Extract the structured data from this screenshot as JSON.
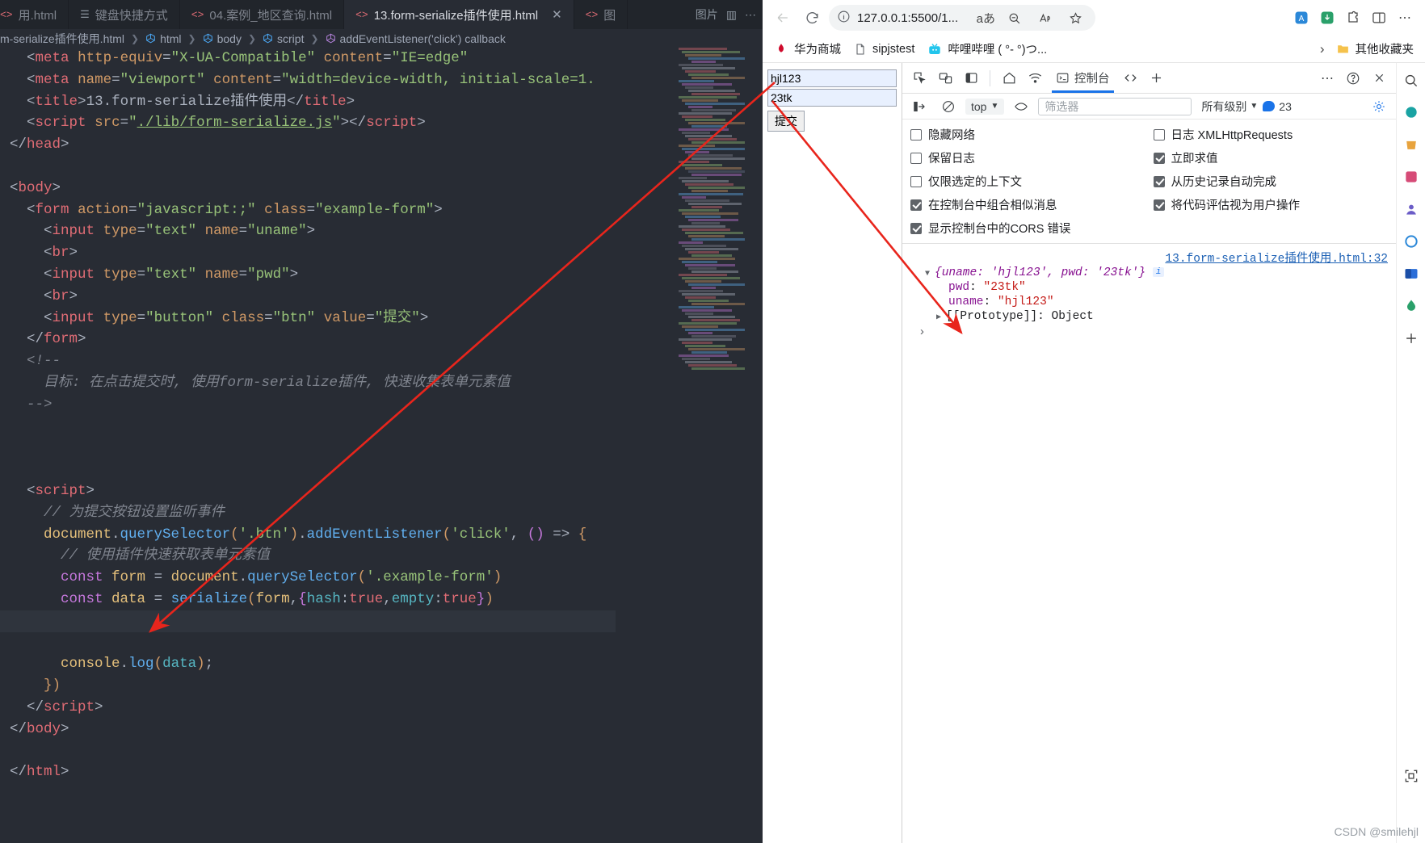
{
  "editor": {
    "tabs": [
      {
        "label": "用.html",
        "icon": "html-file-icon",
        "active": false,
        "closable": false
      },
      {
        "label": "键盘快捷方式",
        "icon": "keyboard-shortcuts-icon",
        "active": false,
        "closable": false
      },
      {
        "label": "04.案例_地区查询.html",
        "icon": "html-file-icon",
        "active": false,
        "closable": false
      },
      {
        "label": "13.form-serialize插件使用.html",
        "icon": "html-file-icon",
        "active": true,
        "closable": true
      },
      {
        "label": "图",
        "icon": "html-file-icon",
        "active": false,
        "closable": false
      }
    ],
    "tab_close_glyph": "✕",
    "tabbar_actions": [
      {
        "name": "images-label",
        "label": "图片"
      },
      {
        "name": "split-editor-icon",
        "label": "▥"
      },
      {
        "name": "more-actions-icon",
        "label": "⋯"
      }
    ],
    "breadcrumb": [
      {
        "label": "m-serialize插件使用.html",
        "icon": "file-icon"
      },
      {
        "label": "html",
        "icon": "symbol-html-icon"
      },
      {
        "label": "body",
        "icon": "symbol-body-icon"
      },
      {
        "label": "script",
        "icon": "symbol-script-icon"
      },
      {
        "label": "addEventListener('click') callback",
        "icon": "symbol-function-icon"
      }
    ],
    "code_lines": [
      {
        "id": "l1",
        "html": "<span class='t-brk'>&lt;</span><span class='t-tag'>meta</span> <span class='t-attr'>http-equiv</span><span class='t-punc'>=</span><span class='t-str'>\"X-UA-Compatible\"</span> <span class='t-attr'>content</span><span class='t-punc'>=</span><span class='t-str'>\"IE=edge\"</span>"
      },
      {
        "id": "l2",
        "html": "<span class='t-brk'>&lt;</span><span class='t-tag'>meta</span> <span class='t-attr'>name</span><span class='t-punc'>=</span><span class='t-str'>\"viewport\"</span> <span class='t-attr'>content</span><span class='t-punc'>=</span><span class='t-str'>\"width=device-width, initial-scale=1.</span>"
      },
      {
        "id": "l3",
        "html": "<span class='t-brk'>&lt;</span><span class='t-tag'>title</span><span class='t-brk'>&gt;</span><span class='t-txt'>13.form-serialize插件使用</span><span class='t-brk'>&lt;/</span><span class='t-tag'>title</span><span class='t-brk'>&gt;</span>"
      },
      {
        "id": "l4",
        "html": "<span class='t-brk'>&lt;</span><span class='t-tag'>script</span> <span class='t-attr'>src</span><span class='t-punc'>=</span><span class='t-str'>\"</span><span class='t-strU'>./lib/form-serialize.js</span><span class='t-str'>\"</span><span class='t-brk'>&gt;&lt;/</span><span class='t-tag'>script</span><span class='t-brk'>&gt;</span>"
      },
      {
        "id": "l5",
        "html": "<span class='t-brk'>&lt;/</span><span class='t-tag'>head</span><span class='t-brk'>&gt;</span>",
        "indent": 0
      },
      {
        "id": "l6",
        "html": ""
      },
      {
        "id": "l7",
        "html": "<span class='t-brk'>&lt;</span><span class='t-tag'>body</span><span class='t-brk'>&gt;</span>",
        "indent": 0
      },
      {
        "id": "l8",
        "html": "<span class='t-brk'>&lt;</span><span class='t-tag'>form</span> <span class='t-attr'>action</span><span class='t-punc'>=</span><span class='t-str'>\"javascript:;\"</span> <span class='t-attr'>class</span><span class='t-punc'>=</span><span class='t-str'>\"example-form\"</span><span class='t-brk'>&gt;</span>"
      },
      {
        "id": "l9",
        "html": "<span class='t-brk'>&lt;</span><span class='t-tag'>input</span> <span class='t-attr'>type</span><span class='t-punc'>=</span><span class='t-str'>\"text\"</span> <span class='t-attr'>name</span><span class='t-punc'>=</span><span class='t-str'>\"uname\"</span><span class='t-brk'>&gt;</span>"
      },
      {
        "id": "l10",
        "html": "<span class='t-brk'>&lt;</span><span class='t-tag'>br</span><span class='t-brk'>&gt;</span>"
      },
      {
        "id": "l11",
        "html": "<span class='t-brk'>&lt;</span><span class='t-tag'>input</span> <span class='t-attr'>type</span><span class='t-punc'>=</span><span class='t-str'>\"text\"</span> <span class='t-attr'>name</span><span class='t-punc'>=</span><span class='t-str'>\"pwd\"</span><span class='t-brk'>&gt;</span>"
      },
      {
        "id": "l12",
        "html": "<span class='t-brk'>&lt;</span><span class='t-tag'>br</span><span class='t-brk'>&gt;</span>"
      },
      {
        "id": "l13",
        "html": "<span class='t-brk'>&lt;</span><span class='t-tag'>input</span> <span class='t-attr'>type</span><span class='t-punc'>=</span><span class='t-str'>\"button\"</span> <span class='t-attr'>class</span><span class='t-punc'>=</span><span class='t-str'>\"btn\"</span> <span class='t-attr'>value</span><span class='t-punc'>=</span><span class='t-str'>\"提交\"</span><span class='t-brk'>&gt;</span>"
      },
      {
        "id": "l14",
        "html": "<span class='t-brk'>&lt;/</span><span class='t-tag'>form</span><span class='t-brk'>&gt;</span>"
      },
      {
        "id": "l15",
        "html": "<span class='t-cmt'>&lt;!--</span>"
      },
      {
        "id": "l16",
        "html": "<span class='t-cmt'>目标: 在点击提交时, 使用form-serialize插件, 快速收集表单元素值</span>"
      },
      {
        "id": "l17",
        "html": "<span class='t-cmt'>--&gt;</span>"
      },
      {
        "id": "l18",
        "html": ""
      },
      {
        "id": "l19",
        "html": ""
      },
      {
        "id": "l20",
        "html": ""
      },
      {
        "id": "l21",
        "html": "<span class='t-brk'>&lt;</span><span class='t-tag'>script</span><span class='t-brk'>&gt;</span>"
      },
      {
        "id": "l22",
        "html": "<span class='t-cmt'>// 为提交按钮设置监听事件</span>"
      },
      {
        "id": "l23",
        "html": "<span class='t-var'>document</span><span class='t-punc'>.</span><span class='t-fn'>querySelector</span><span class='t-paren1'>(</span><span class='t-str'>'.btn'</span><span class='t-paren1'>)</span><span class='t-punc'>.</span><span class='t-fn'>addEventListener</span><span class='t-paren1'>(</span><span class='t-str'>'click'</span><span class='t-punc'>, </span><span class='t-paren2'>()</span> <span class='t-punc'>=&gt;</span> <span class='t-paren1'>{</span>"
      },
      {
        "id": "l24",
        "html": "<span class='t-cmt'>// 使用插件快速获取表单元素值</span>"
      },
      {
        "id": "l25",
        "html": "<span class='t-kw'>const</span> <span class='t-var'>form</span> <span class='t-punc'>=</span> <span class='t-var'>document</span><span class='t-punc'>.</span><span class='t-fn'>querySelector</span><span class='t-paren1'>(</span><span class='t-str'>'.example-form'</span><span class='t-paren1'>)</span>"
      },
      {
        "id": "l26",
        "html": "<span class='t-kw'>const</span> <span class='t-var'>data</span> <span class='t-punc'>=</span> <span class='t-fn'>serialize</span><span class='t-paren1'>(</span><span class='t-var'>form</span><span class='t-punc'>,</span><span class='t-paren2'>{</span><span class='t-prop'>hash</span><span class='t-punc'>:</span><span class='t-tag'>true</span><span class='t-punc'>,</span><span class='t-prop'>empty</span><span class='t-punc'>:</span><span class='t-tag'>true</span><span class='t-paren2'>}</span><span class='t-paren1'>)</span>"
      },
      {
        "id": "l27",
        "html": "",
        "highlight": true
      },
      {
        "id": "l28",
        "html": ""
      },
      {
        "id": "l29",
        "html": "<span class='t-var'>console</span><span class='t-punc'>.</span><span class='t-fn'>log</span><span class='t-paren1'>(</span><span class='t-prop'>data</span><span class='t-paren1'>)</span><span class='t-punc'>;</span>"
      },
      {
        "id": "l30",
        "html": "<span class='t-paren1'>}</span><span class='t-paren1'>)</span>"
      },
      {
        "id": "l31",
        "html": "<span class='t-brk'>&lt;/</span><span class='t-tag'>script</span><span class='t-brk'>&gt;</span>"
      },
      {
        "id": "l32",
        "html": "<span class='t-brk'>&lt;/</span><span class='t-tag'>body</span><span class='t-brk'>&gt;</span>"
      },
      {
        "id": "l33",
        "html": ""
      },
      {
        "id": "l34",
        "html": "<span class='t-brk'>&lt;/</span><span class='t-tag'>html</span><span class='t-brk'>&gt;</span>"
      }
    ]
  },
  "browser": {
    "toolbar": {
      "back_label": "←",
      "forward_label": "→",
      "reload_label": "⟳",
      "url_value": "127.0.0.1:5500/1...",
      "info_icon_label": "ⓘ",
      "read_aloud_label": "aあ",
      "zoom_out_label": "⊖",
      "immersive_reader_label": "A",
      "favorite_label": "☆"
    },
    "bookmarks": [
      {
        "label": "华为商城",
        "icon": "huawei-icon"
      },
      {
        "label": "sipjstest",
        "icon": "page-icon"
      },
      {
        "label": "哔哩哔哩 ( °- °)つ...",
        "icon": "bilibili-icon"
      }
    ],
    "bookmarks_overflow": "›",
    "other_favorites": "其他收藏夹",
    "rail_icons": [
      "search-icon",
      "copilot-icon",
      "shopping-icon",
      "collections-icon",
      "profile-icon",
      "browser-essentials-icon",
      "outlook-icon",
      "drop-icon",
      "add-icon",
      "screenshot-icon"
    ]
  },
  "page": {
    "uname_value": "hjl123",
    "pwd_value": "23tk",
    "submit_label": "提交"
  },
  "devtools": {
    "toolbar_icons": [
      "inspect-icon",
      "device-toolbar-icon",
      "dock-side-icon"
    ],
    "tabs": [
      {
        "label": "",
        "icon": "home-icon",
        "active": false
      },
      {
        "label": "",
        "icon": "network-icon",
        "active": false
      },
      {
        "label": "控制台",
        "icon": "console-icon",
        "active": true
      },
      {
        "label": "",
        "icon": "sources-icon",
        "active": false
      },
      {
        "label": "",
        "icon": "add-tab-icon",
        "active": false
      }
    ],
    "more_label": "⋯",
    "help_label": "?",
    "close_label": "✕",
    "filterbar": {
      "clear_console_label": "clear-console-icon",
      "no_entry_label": "no-entry-icon",
      "context": "top",
      "eye_icon": "live-expression-icon",
      "filter_placeholder": "筛选器",
      "levels_label": "所有级别",
      "issues_count": "23"
    },
    "settings_left": [
      {
        "label": "隐藏网络",
        "checked": false
      },
      {
        "label": "保留日志",
        "checked": false
      },
      {
        "label": "仅限选定的上下文",
        "checked": false
      },
      {
        "label": "在控制台中组合相似消息",
        "checked": true
      },
      {
        "label": "显示控制台中的CORS 错误",
        "checked": true
      }
    ],
    "settings_right": [
      {
        "label": "日志 XMLHttpRequests",
        "checked": false
      },
      {
        "label": "立即求值",
        "checked": true
      },
      {
        "label": "从历史记录自动完成",
        "checked": true
      },
      {
        "label": "将代码评估视为用户操作",
        "checked": true
      }
    ],
    "console": {
      "source_link": "13.form-serialize插件使用.html:32",
      "object_preview": "{uname: 'hjl123', pwd: '23tk'}",
      "info_badge": "i",
      "expand_glyph": "▼",
      "collapse_glyph": "▶",
      "entries": [
        {
          "key": "pwd",
          "value": "\"23tk\""
        },
        {
          "key": "uname",
          "value": "\"hjl123\""
        }
      ],
      "prototype_label": "[[Prototype]]: Object",
      "prompt_glyph": "›"
    }
  },
  "watermark": "CSDN @smilehjl",
  "colors": {
    "accent": "#1a73e8",
    "editor_bg": "#282c34",
    "tabbar_bg": "#21252b",
    "annotation_red": "#e8251c",
    "input_bg": "#e8f0fe"
  }
}
